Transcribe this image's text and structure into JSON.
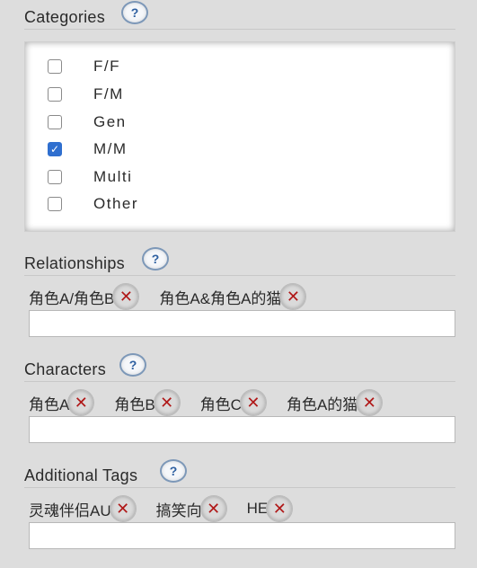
{
  "categories": {
    "title": "Categories",
    "help": "?",
    "options": [
      {
        "label": "F/F",
        "checked": false
      },
      {
        "label": "F/M",
        "checked": false
      },
      {
        "label": "Gen",
        "checked": false
      },
      {
        "label": "M/M",
        "checked": true
      },
      {
        "label": "Multi",
        "checked": false
      },
      {
        "label": "Other",
        "checked": false
      }
    ]
  },
  "relationships": {
    "title": "Relationships",
    "help": "?",
    "tags": [
      "角色A/角色B",
      "角色A&角色A的猫"
    ],
    "input_value": ""
  },
  "characters": {
    "title": "Characters",
    "help": "?",
    "tags": [
      "角色A",
      "角色B",
      "角色C",
      "角色A的猫"
    ],
    "input_value": ""
  },
  "additional_tags": {
    "title": "Additional Tags",
    "help": "?",
    "tags": [
      "灵魂伴侣AU",
      "搞笑向",
      "HE"
    ],
    "input_value": ""
  },
  "remove_symbol": "✕",
  "check_symbol": "✓",
  "colors": {
    "background": "#dddddd",
    "checkbox_checked": "#2f6fcf",
    "remove_x": "#b01818",
    "help_text": "#2d5fa0"
  }
}
